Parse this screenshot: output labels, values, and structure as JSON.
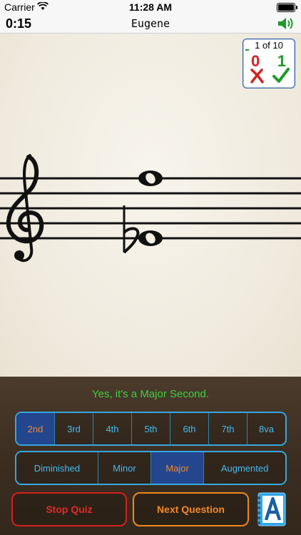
{
  "status_bar": {
    "carrier": "Carrier",
    "time": "11:28 AM"
  },
  "header": {
    "timer": "0:15",
    "player_name": "Eugene",
    "speaker_icon": "speaker-volume-icon"
  },
  "score": {
    "progress": "1 of 10",
    "wrong": "0",
    "right": "1"
  },
  "feedback": {
    "message": "Yes, it's a Major Second.",
    "color": "#3fcf3f"
  },
  "intervals": {
    "options": [
      "2nd",
      "3rd",
      "4th",
      "5th",
      "6th",
      "7th",
      "8va"
    ],
    "selected": "2nd"
  },
  "qualities": {
    "options": [
      "Diminished",
      "Minor",
      "Major",
      "Augmented"
    ],
    "selected": "Major"
  },
  "buttons": {
    "stop": "Stop Quiz",
    "next": "Next Question"
  },
  "colors": {
    "accent_blue": "#35a7e0",
    "selected_bg": "#23468e",
    "selected_text": "#f08a2a",
    "stop_red": "#d61f1f",
    "next_orange": "#f0881e"
  }
}
